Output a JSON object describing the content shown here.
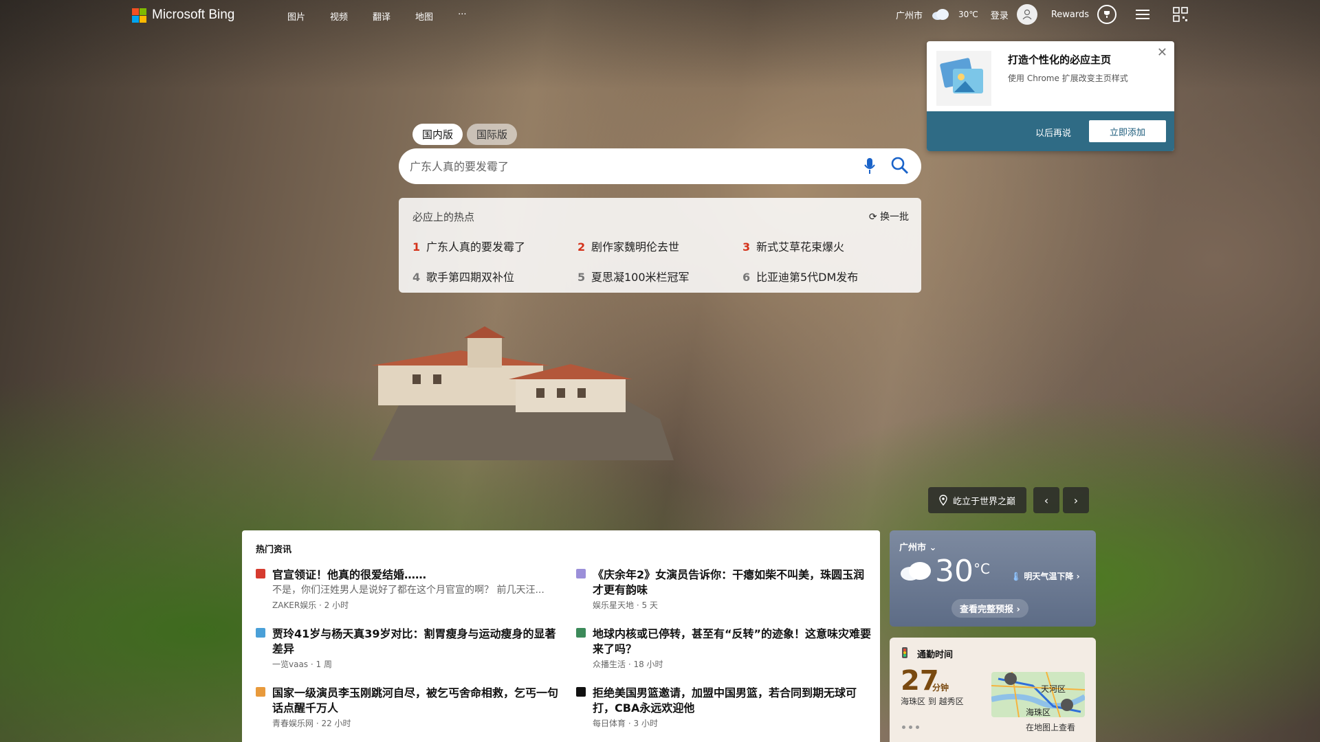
{
  "header": {
    "brand": "Microsoft Bing",
    "nav": [
      "图片",
      "视频",
      "翻译",
      "地图",
      "···"
    ],
    "city": "广州市",
    "temp": "30℃",
    "login": "登录",
    "rewards": "Rewards"
  },
  "popup": {
    "title": "打造个性化的必应主页",
    "subtitle": "使用 Chrome 扩展改变主页样式",
    "later": "以后再说",
    "add": "立即添加",
    "close": "✕"
  },
  "search": {
    "tabs": [
      "国内版",
      "国际版"
    ],
    "placeholder": "广东人真的要发霉了"
  },
  "hot": {
    "title": "必应上的热点",
    "refresh": "换一批",
    "items": [
      {
        "num": "1",
        "text": "广东人真的要发霉了"
      },
      {
        "num": "2",
        "text": "剧作家魏明伦去世"
      },
      {
        "num": "3",
        "text": "新式艾草花束爆火"
      },
      {
        "num": "4",
        "text": "歌手第四期双补位"
      },
      {
        "num": "5",
        "text": "夏思凝100米栏冠军"
      },
      {
        "num": "6",
        "text": "比亚迪第5代DM发布"
      }
    ]
  },
  "location": {
    "label": "屹立于世界之巅",
    "prev": "‹",
    "next": "›"
  },
  "news": {
    "title": "热门资讯",
    "items": [
      {
        "headline": "官宣领证！他真的很爱结婚……",
        "snippet": "不是，你们汪姓男人是说好了都在这个月官宣的啊？ 前几天汪...",
        "meta": "ZAKER娱乐 · 2 小时"
      },
      {
        "headline": "《庆余年2》女演员告诉你：干瘪如柴不叫美，珠圆玉润才更有韵味",
        "snippet": "",
        "meta": "娱乐星天地 · 5 天"
      },
      {
        "headline": "贾玲41岁与杨天真39岁对比：割胃瘦身与运动瘦身的显著差异",
        "snippet": "",
        "meta": "一览vaas · 1 周"
      },
      {
        "headline": "地球内核或已停转，甚至有“反转”的迹象！这意味灾难要来了吗？",
        "snippet": "",
        "meta": "众播生活 · 18 小时"
      },
      {
        "headline": "国家一级演员李玉刚跳河自尽，被乞丐舍命相救，乞丐一句话点醒千万人",
        "snippet": "",
        "meta": "青春娱乐网 · 22 小时"
      },
      {
        "headline": "拒绝美国男篮邀请，加盟中国男篮，若合同到期无球可打，CBA永远欢迎他",
        "snippet": "",
        "meta": "每日体育 · 3 小时"
      }
    ]
  },
  "weather": {
    "city": "广州市",
    "temp": "30",
    "unit": "°C",
    "alert": "明天气温下降",
    "full": "查看完整预报"
  },
  "commute": {
    "title": "通勤时间",
    "minutes": "27",
    "unit": "分钟",
    "route": "海珠区 到 越秀区",
    "map_label_1": "天河区",
    "map_label_2": "海珠区",
    "map_link": "在地图上查看"
  },
  "colors": {
    "logo": [
      "#f25022",
      "#7fba00",
      "#00a4ef",
      "#ffb900"
    ],
    "hot_rank_red": "#d4321a",
    "popup_bar": "#2f6b85"
  }
}
